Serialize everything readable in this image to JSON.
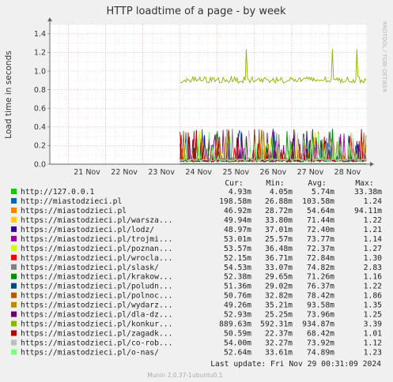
{
  "chart_data": {
    "type": "line",
    "title": "HTTP loadtime of a page - by week",
    "ylabel": "Load time in seconds",
    "ylim": [
      0,
      1.5
    ],
    "yticks": [
      {
        "v": 0,
        "t": "0.0"
      },
      {
        "v": 0.2,
        "t": "0.2"
      },
      {
        "v": 0.4,
        "t": "0.4"
      },
      {
        "v": 0.6,
        "t": "0.6"
      },
      {
        "v": 0.8,
        "t": "0.8"
      },
      {
        "v": 1.0,
        "t": "1.0"
      },
      {
        "v": 1.2,
        "t": "1.2"
      },
      {
        "v": 1.4,
        "t": "1.4"
      }
    ],
    "xlim": [
      "2024-11-20T12:00",
      "2024-11-29T00:30"
    ],
    "xticks": [
      {
        "v": "2024-11-21",
        "t": "21 Nov"
      },
      {
        "v": "2024-11-22",
        "t": "22 Nov"
      },
      {
        "v": "2024-11-23",
        "t": "23 Nov"
      },
      {
        "v": "2024-11-24",
        "t": "24 Nov"
      },
      {
        "v": "2024-11-25",
        "t": "25 Nov"
      },
      {
        "v": "2024-11-26",
        "t": "26 Nov"
      },
      {
        "v": "2024-11-27",
        "t": "27 Nov"
      },
      {
        "v": "2024-11-28",
        "t": "28 Nov"
      }
    ],
    "grid": true,
    "data_start": "2024-11-24T00:00",
    "side_label": "RRDTOOL / TOBI OETIKER",
    "legend_headers": {
      "cur": "Cur:",
      "min": "Min:",
      "avg": "Avg:",
      "max": "Max:"
    },
    "series": [
      {
        "name": "http://127.0.0.1",
        "color": "#00cc00",
        "cur": "4.93m",
        "min": "4.05m",
        "avg": "5.74m",
        "max": "33.38m"
      },
      {
        "name": "http://miastodzieci.pl",
        "color": "#0066b3",
        "cur": "198.58m",
        "min": "26.88m",
        "avg": "103.58m",
        "max": "1.24"
      },
      {
        "name": "https://miastodzieci.pl",
        "color": "#ff8000",
        "cur": "46.92m",
        "min": "28.72m",
        "avg": "54.64m",
        "max": "94.11m"
      },
      {
        "name": "https://miastodzieci.pl/warsza...",
        "color": "#ffcc00",
        "cur": "49.94m",
        "min": "33.80m",
        "avg": "71.44m",
        "max": "1.22"
      },
      {
        "name": "https://miastodzieci.pl/lodz/",
        "color": "#330099",
        "cur": "48.97m",
        "min": "37.01m",
        "avg": "72.40m",
        "max": "1.21"
      },
      {
        "name": "https://miastodzieci.pl/trojmi...",
        "color": "#990099",
        "cur": "53.01m",
        "min": "25.57m",
        "avg": "73.77m",
        "max": "1.14"
      },
      {
        "name": "https://miastodzieci.pl/poznan...",
        "color": "#ccff00",
        "cur": "53.57m",
        "min": "36.48m",
        "avg": "72.37m",
        "max": "1.27"
      },
      {
        "name": "https://miastodzieci.pl/wrocla...",
        "color": "#ff0000",
        "cur": "52.15m",
        "min": "36.71m",
        "avg": "72.84m",
        "max": "1.30"
      },
      {
        "name": "https://miastodzieci.pl/slask/",
        "color": "#808080",
        "cur": "54.53m",
        "min": "33.07m",
        "avg": "74.82m",
        "max": "2.83"
      },
      {
        "name": "https://miastodzieci.pl/krakow...",
        "color": "#008f00",
        "cur": "52.38m",
        "min": "29.65m",
        "avg": "71.26m",
        "max": "1.16"
      },
      {
        "name": "https://miastodzieci.pl/poludn...",
        "color": "#00487d",
        "cur": "51.36m",
        "min": "29.02m",
        "avg": "76.37m",
        "max": "1.22"
      },
      {
        "name": "https://miastodzieci.pl/polnoc...",
        "color": "#b35a00",
        "cur": "50.76m",
        "min": "32.82m",
        "avg": "78.42m",
        "max": "1.86"
      },
      {
        "name": "https://miastodzieci.pl/wydarz...",
        "color": "#b38f00",
        "cur": "49.26m",
        "min": "35.21m",
        "avg": "93.58m",
        "max": "1.35"
      },
      {
        "name": "https://miastodzieci.pl/dla-dz...",
        "color": "#6b006b",
        "cur": "52.93m",
        "min": "25.25m",
        "avg": "73.96m",
        "max": "1.25"
      },
      {
        "name": "https://miastodzieci.pl/konkur...",
        "color": "#8fb300",
        "cur": "889.63m",
        "min": "592.31m",
        "avg": "934.87m",
        "max": "3.39"
      },
      {
        "name": "https://miastodzieci.pl/zagadk...",
        "color": "#b30000",
        "cur": "50.59m",
        "min": "22.37m",
        "avg": "68.42m",
        "max": "1.01"
      },
      {
        "name": "https://miastodzieci.pl/co-rob...",
        "color": "#bebebe",
        "cur": "54.00m",
        "min": "32.27m",
        "avg": "73.92m",
        "max": "1.12"
      },
      {
        "name": "https://miastodzieci.pl/o-nas/",
        "color": "#80ff80",
        "cur": "52.64m",
        "min": "33.61m",
        "avg": "74.89m",
        "max": "1.23"
      }
    ],
    "last_update": "Last update: Fri Nov 29 00:31:09 2024",
    "munin_version": "Munin 2.0.37-1ubuntu0.1"
  }
}
